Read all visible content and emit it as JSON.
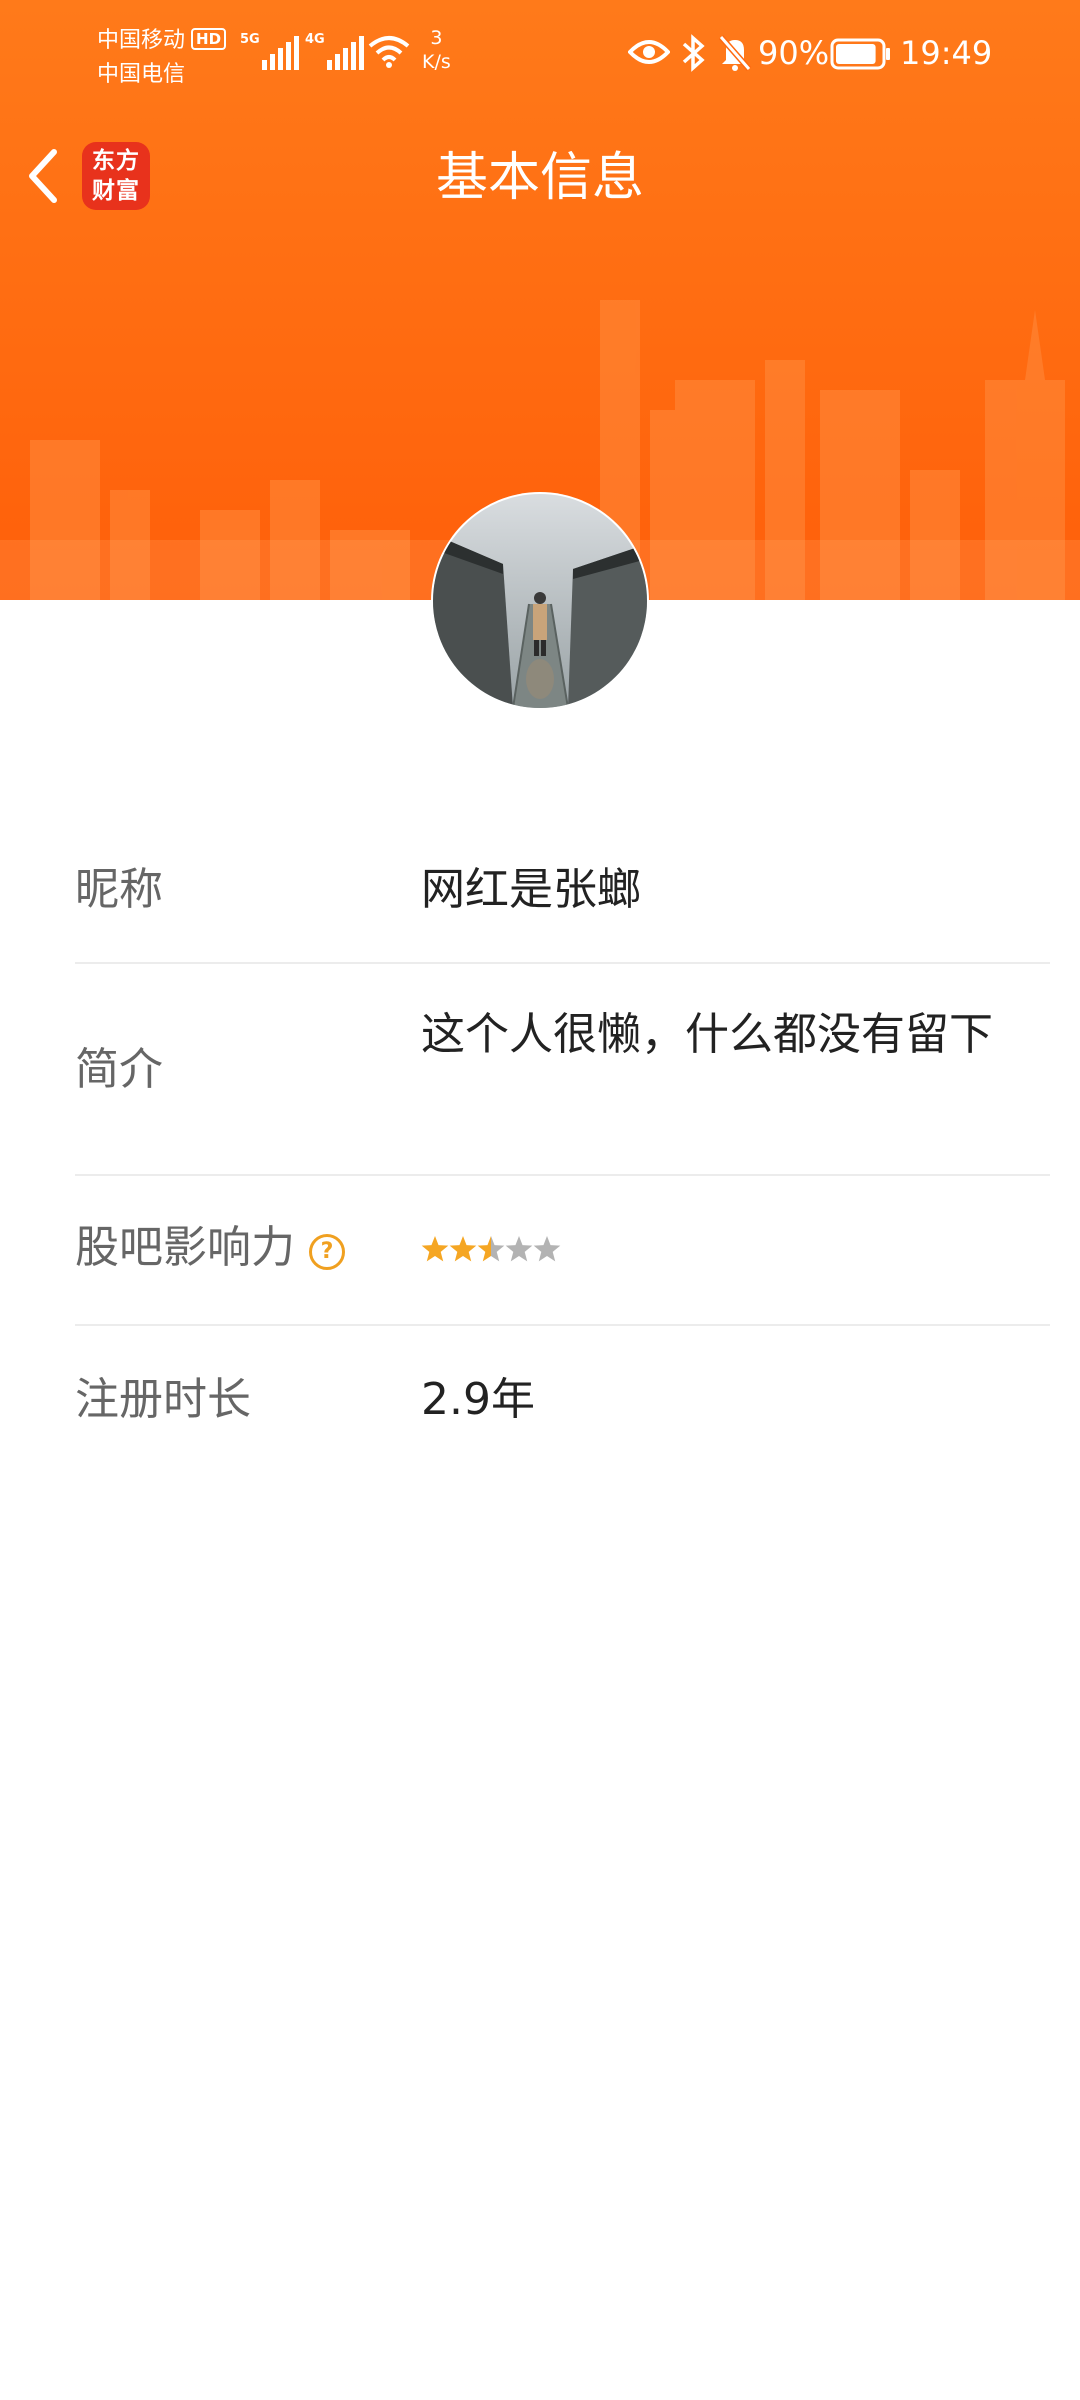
{
  "status_bar": {
    "carrier_1": "中国移动",
    "carrier_hd": "HD",
    "carrier_2": "中国电信",
    "net_1": "5G",
    "net_2": "4G",
    "speed_value": "3",
    "speed_unit": "K/s",
    "battery_percent": "90%",
    "battery_level": 0.9,
    "time": "19:49"
  },
  "nav": {
    "title": "基本信息",
    "app_badge_line1": "东方",
    "app_badge_line2": "财富"
  },
  "profile": {
    "rows": [
      {
        "label": "昵称",
        "value": "网红是张螂"
      },
      {
        "label": "简介",
        "value": "这个人很懒，什么都没有留下"
      },
      {
        "label": "股吧影响力",
        "help": "?",
        "rating": 2.5,
        "rating_max": 5
      },
      {
        "label": "注册时长",
        "value": "2.9年"
      }
    ]
  },
  "colors": {
    "brand_orange": "#ff6a10",
    "star_on": "#f5a623",
    "star_off": "#b3b3b3",
    "badge_red": "#e8321c"
  }
}
